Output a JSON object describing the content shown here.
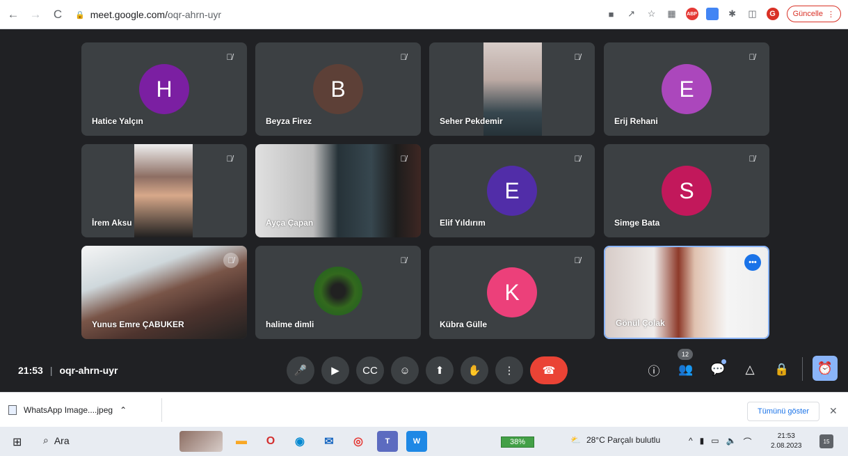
{
  "browser": {
    "url_host": "meet.google.com/",
    "url_path": "oqr-ahrn-uyr",
    "update_label": "Güncelle",
    "profile_initial": "G"
  },
  "participants": [
    {
      "name": "Hatice Yalçın",
      "initial": "H",
      "color": "#7b1fa2"
    },
    {
      "name": "Beyza Firez",
      "initial": "B",
      "color": "#5d4037"
    },
    {
      "name": "Seher Pekdemir",
      "initial": "",
      "color": ""
    },
    {
      "name": "Erij Rehani",
      "initial": "E",
      "color": "#ab47bc"
    },
    {
      "name": "İrem Aksu",
      "initial": "",
      "color": ""
    },
    {
      "name": "Ayça Çapan",
      "initial": "",
      "color": ""
    },
    {
      "name": "Elif Yıldırım",
      "initial": "E",
      "color": "#512da8"
    },
    {
      "name": "Simge Bata",
      "initial": "S",
      "color": "#c2185b"
    },
    {
      "name": "Yunus Emre ÇABUKER",
      "initial": "",
      "color": ""
    },
    {
      "name": "halime dimli",
      "initial": "",
      "color": ""
    },
    {
      "name": "Kübra Gülle",
      "initial": "K",
      "color": "#ec407a"
    },
    {
      "name": "Gönül Çolak",
      "initial": "",
      "color": ""
    }
  ],
  "meeting": {
    "time": "21:53",
    "code": "oqr-ahrn-uyr",
    "participant_count": "12"
  },
  "download": {
    "file_name": "WhatsApp Image....jpeg",
    "show_all_label": "Tümünü göster"
  },
  "taskbar": {
    "search_label": "Ara",
    "battery_label": "38%",
    "weather_label": "28°C  Parçalı bulutlu",
    "time": "21:53",
    "date": "2.08.2023",
    "notification_count": "15"
  }
}
